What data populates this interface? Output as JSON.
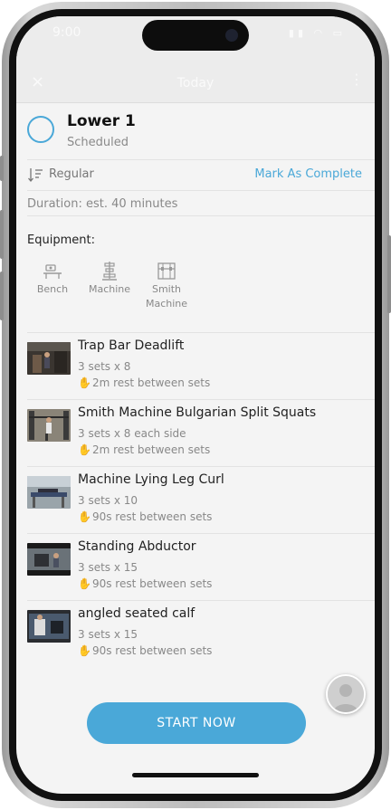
{
  "status_bar": {
    "time": "9:00",
    "icons": "▮▮ ◠ ▭"
  },
  "navbar": {
    "close_icon": "×",
    "title": "Today",
    "more_icon": "⋮"
  },
  "workout": {
    "name": "Lower 1",
    "status": "Scheduled"
  },
  "order": {
    "label": "Regular",
    "mark_complete": "Mark As Complete"
  },
  "duration": "Duration: est. 40 minutes",
  "equipment": {
    "title": "Equipment:",
    "items": [
      {
        "label": "Bench",
        "icon": "bench-icon"
      },
      {
        "label": "Machine",
        "icon": "machine-icon"
      },
      {
        "label": "Smith Machine",
        "icon": "smith-machine-icon"
      }
    ]
  },
  "exercises": [
    {
      "name": "Trap Bar Deadlift",
      "sets": "3 sets x 8",
      "rest": "2m rest between sets"
    },
    {
      "name": "Smith Machine Bulgarian Split Squats",
      "sets": "3 sets x 8 each side",
      "rest": "2m rest between sets"
    },
    {
      "name": "Machine Lying Leg Curl",
      "sets": "3 sets x 10",
      "rest": "90s rest between sets"
    },
    {
      "name": "Standing Abductor",
      "sets": "3 sets x 15",
      "rest": "90s rest between sets"
    },
    {
      "name": "angled seated calf",
      "sets": "3 sets x 15",
      "rest": "90s rest between sets"
    }
  ],
  "rest_icon": "✋",
  "start_button": "START NOW",
  "colors": {
    "accent": "#4aa8d8",
    "muted_text": "#888888",
    "rest_icon": "#e8a030"
  }
}
